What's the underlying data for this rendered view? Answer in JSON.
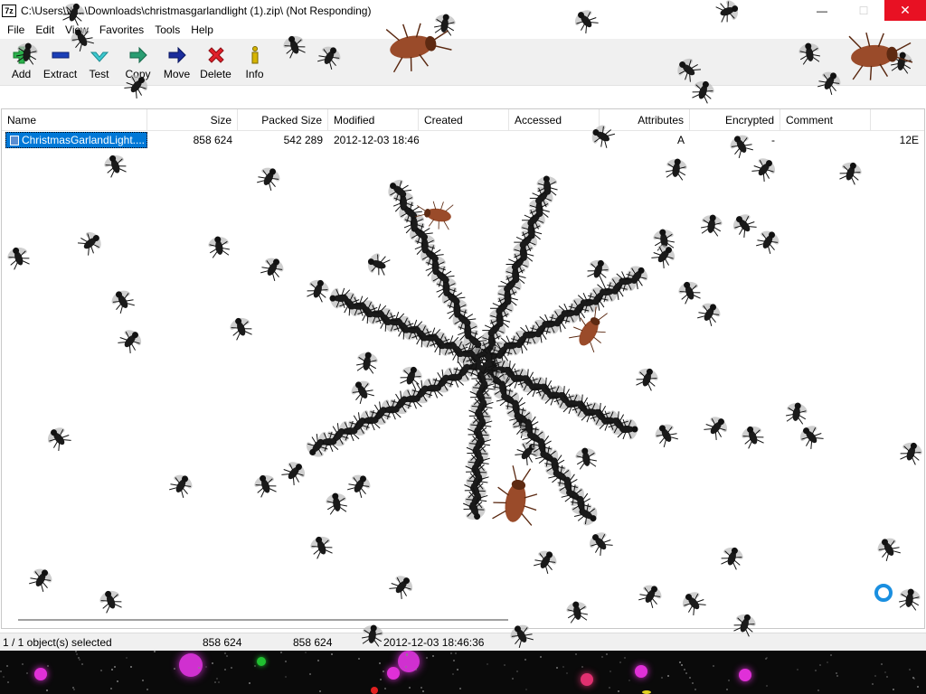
{
  "window": {
    "app_icon_text": "7z",
    "title": "C:\\Users\\W...\\Downloads\\christmasgarlandlight (1).zip\\ (Not Responding)",
    "minimize_glyph": "—",
    "maximize_glyph": "☐",
    "close_glyph": "✕"
  },
  "menu": [
    "File",
    "Edit",
    "View",
    "Favorites",
    "Tools",
    "Help"
  ],
  "toolbar": [
    {
      "label": "Add",
      "icon": "plus-icon",
      "color": "#2bb24c"
    },
    {
      "label": "Extract",
      "icon": "minus-icon",
      "color": "#1b3fb8"
    },
    {
      "label": "Test",
      "icon": "check-icon",
      "color": "#3cc9d0"
    },
    {
      "label": "Copy",
      "icon": "copy-arrow-icon",
      "color": "#2a9d72"
    },
    {
      "label": "Move",
      "icon": "move-arrow-icon",
      "color": "#1b2d9c"
    },
    {
      "label": "Delete",
      "icon": "delete-x-icon",
      "color": "#e0202a"
    },
    {
      "label": "Info",
      "icon": "info-icon",
      "color": "#d6b400"
    }
  ],
  "columns": [
    "Name",
    "Size",
    "Packed Size",
    "Modified",
    "Created",
    "Accessed",
    "Attributes",
    "Encrypted",
    "Comment"
  ],
  "rows": [
    {
      "name": "ChristmasGarlandLight....",
      "size": "858 624",
      "packed": "542 289",
      "modified": "2012-12-03 18:46",
      "created": "",
      "accessed": "",
      "attributes": "A",
      "encrypted": "-",
      "comment": "",
      "overflow": "12E"
    }
  ],
  "status": {
    "selection": "1 / 1 object(s) selected",
    "size": "858 624",
    "packed": "858 624",
    "modified": "2012-12-03 18:46:36"
  },
  "colors": {
    "selection": "#0078d7",
    "close_button": "#e81123",
    "spinner": "#1a8fe0"
  }
}
